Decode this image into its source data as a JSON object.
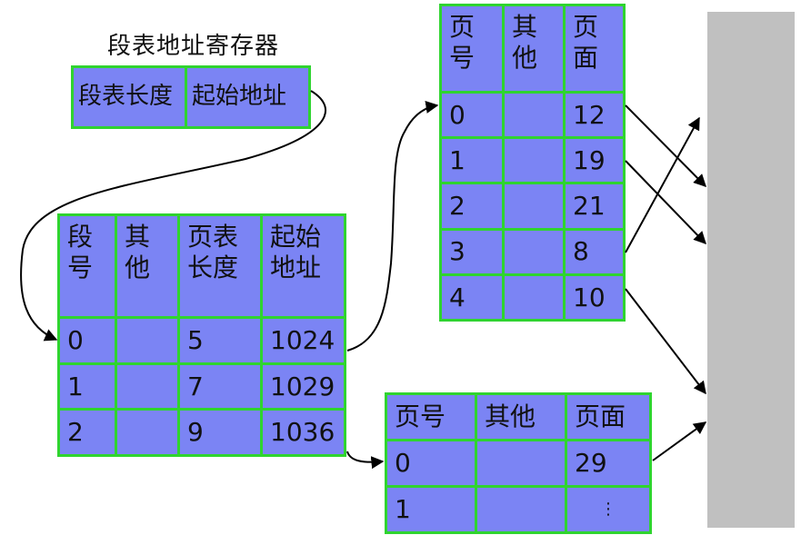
{
  "register": {
    "title": "段表地址寄存器",
    "length_label": "段表长度",
    "start_label": "起始地址"
  },
  "segment_table": {
    "headers": [
      "段\n号",
      "其\n他",
      "页表\n长度",
      "起始\n地址"
    ],
    "rows": [
      [
        "0",
        "",
        "5",
        "1024"
      ],
      [
        "1",
        "",
        "7",
        "1029"
      ],
      [
        "2",
        "",
        "9",
        "1036"
      ]
    ]
  },
  "page_table_0": {
    "headers": [
      "页\n号",
      "其\n他",
      "页\n面"
    ],
    "rows": [
      [
        "0",
        "",
        "12"
      ],
      [
        "1",
        "",
        "19"
      ],
      [
        "2",
        "",
        "21"
      ],
      [
        "3",
        "",
        "8"
      ],
      [
        "4",
        "",
        "10"
      ]
    ]
  },
  "page_table_2": {
    "headers": [
      "页号",
      "其他",
      "页面"
    ],
    "rows": [
      [
        "0",
        "",
        "29"
      ],
      [
        "1",
        "",
        "⋮"
      ]
    ]
  },
  "colors": {
    "cell_fill": "#7b84f4",
    "cell_border": "#2fd42f",
    "memory_fill": "#c0c0c0",
    "arrow": "#000000"
  }
}
